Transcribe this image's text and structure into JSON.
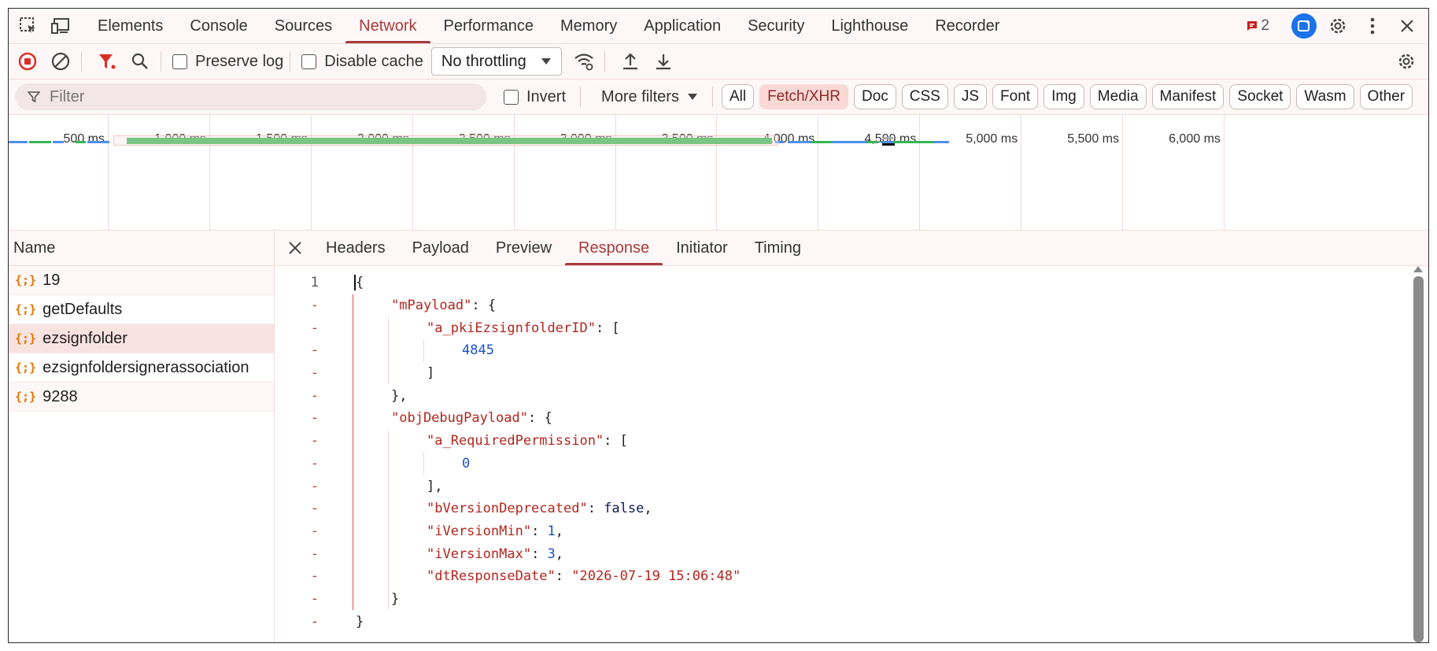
{
  "tabs": [
    "Elements",
    "Console",
    "Sources",
    "Network",
    "Performance",
    "Memory",
    "Application",
    "Security",
    "Lighthouse",
    "Recorder"
  ],
  "active_tab": "Network",
  "issues_count": "2",
  "toolbar": {
    "preserve_log": "Preserve log",
    "disable_cache": "Disable cache",
    "throttling": "No throttling"
  },
  "filter": {
    "placeholder": "Filter",
    "invert": "Invert",
    "more_filters": "More filters",
    "chips": [
      "All",
      "Fetch/XHR",
      "Doc",
      "CSS",
      "JS",
      "Font",
      "Img",
      "Media",
      "Manifest",
      "Socket",
      "Wasm",
      "Other"
    ],
    "active_chip": "Fetch/XHR"
  },
  "timeline": {
    "ticks": [
      "500 ms",
      "1,000 ms",
      "1,500 ms",
      "2,000 ms",
      "2,500 ms",
      "3,000 ms",
      "3,500 ms",
      "4,000 ms",
      "4,500 ms",
      "5,000 ms",
      "5,500 ms",
      "6,000 ms"
    ]
  },
  "requests": {
    "header": "Name",
    "items": [
      "19",
      "getDefaults",
      "ezsignfolder",
      "ezsignfoldersignerassociation",
      "9288"
    ],
    "selected": "ezsignfolder"
  },
  "detail": {
    "tabs": [
      "Headers",
      "Payload",
      "Preview",
      "Response",
      "Initiator",
      "Timing"
    ],
    "active_tab": "Response",
    "gutter": [
      "1",
      "-",
      "-",
      "-",
      "-",
      "-",
      "-",
      "-",
      "-",
      "-",
      "-",
      "-",
      "-",
      "-",
      "-",
      "-"
    ],
    "lines": [
      {
        "indent": 0,
        "parts": [
          [
            "punc",
            "{"
          ]
        ]
      },
      {
        "indent": 1,
        "parts": [
          [
            "key",
            "\"mPayload\""
          ],
          [
            "punc",
            ": {"
          ]
        ]
      },
      {
        "indent": 2,
        "parts": [
          [
            "key",
            "\"a_pkiEzsignfolderID\""
          ],
          [
            "punc",
            ": ["
          ]
        ]
      },
      {
        "indent": 3,
        "parts": [
          [
            "num-v",
            "4845"
          ]
        ]
      },
      {
        "indent": 2,
        "parts": [
          [
            "punc",
            "]"
          ]
        ]
      },
      {
        "indent": 1,
        "parts": [
          [
            "punc",
            "},"
          ]
        ]
      },
      {
        "indent": 1,
        "parts": [
          [
            "key",
            "\"objDebugPayload\""
          ],
          [
            "punc",
            ": {"
          ]
        ]
      },
      {
        "indent": 2,
        "parts": [
          [
            "key",
            "\"a_RequiredPermission\""
          ],
          [
            "punc",
            ": ["
          ]
        ]
      },
      {
        "indent": 3,
        "parts": [
          [
            "num-v",
            "0"
          ]
        ]
      },
      {
        "indent": 2,
        "parts": [
          [
            "punc",
            "],"
          ]
        ]
      },
      {
        "indent": 2,
        "parts": [
          [
            "key",
            "\"bVersionDeprecated\""
          ],
          [
            "punc",
            ": "
          ],
          [
            "kw",
            "false"
          ],
          [
            "punc",
            ","
          ]
        ]
      },
      {
        "indent": 2,
        "parts": [
          [
            "key",
            "\"iVersionMin\""
          ],
          [
            "punc",
            ": "
          ],
          [
            "num-v",
            "1"
          ],
          [
            "punc",
            ","
          ]
        ]
      },
      {
        "indent": 2,
        "parts": [
          [
            "key",
            "\"iVersionMax\""
          ],
          [
            "punc",
            ": "
          ],
          [
            "num-v",
            "3"
          ],
          [
            "punc",
            ","
          ]
        ]
      },
      {
        "indent": 2,
        "parts": [
          [
            "key",
            "\"dtResponseDate\""
          ],
          [
            "punc",
            ": "
          ],
          [
            "str",
            "\"2026-07-19 15:06:48\""
          ]
        ]
      },
      {
        "indent": 1,
        "parts": [
          [
            "punc",
            "}"
          ]
        ]
      },
      {
        "indent": 0,
        "parts": [
          [
            "punc",
            "}"
          ]
        ]
      }
    ]
  },
  "colors": {
    "accent": "#a73b3b",
    "green": "#34b552",
    "blue": "#4f8fe8",
    "record": "#d93025"
  }
}
